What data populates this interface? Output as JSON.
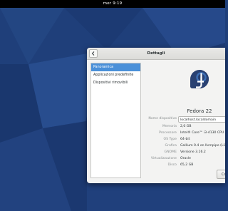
{
  "topbar": {
    "clock": "mer 9:19"
  },
  "window": {
    "title": "Dettagli"
  },
  "sidebar": {
    "items": [
      {
        "label": "Panoramica",
        "active": true
      },
      {
        "label": "Applicazioni predefinite",
        "active": false
      },
      {
        "label": "Dispositivi rimovibili",
        "active": false
      }
    ]
  },
  "overview": {
    "os_name": "Fedora 22",
    "device_name_label": "Nome dispositivo",
    "device_name_value": "localhost.localdomain",
    "rows": [
      {
        "label": "Memoria",
        "value": "2,0 GB"
      },
      {
        "label": "Processore",
        "value": "Intel® Core™ i3-4130 CPU @"
      },
      {
        "label": "OS Type",
        "value": "64-bit"
      },
      {
        "label": "Grafica",
        "value": "Gallium 0.4 on llvmpipe (LLV"
      },
      {
        "label": "GNOME",
        "value": "Versione 3.16.2"
      },
      {
        "label": "Virtualizzazione",
        "value": "Oracle"
      },
      {
        "label": "Disco",
        "value": "65,2 GB"
      }
    ],
    "check_button": "Co"
  },
  "colors": {
    "accent": "#4a90d9",
    "fedora_blue": "#294172",
    "desktop": "#1f3f7a"
  },
  "icons": {
    "back": "chevron-left-icon",
    "logo": "fedora-logo-icon"
  }
}
